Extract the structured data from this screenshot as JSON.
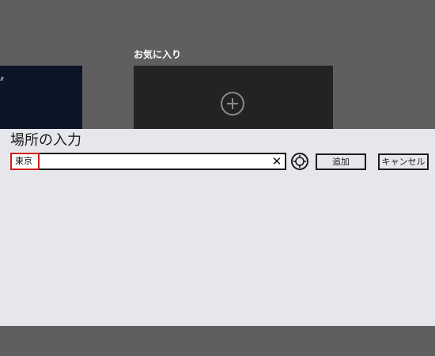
{
  "background": {
    "favorites_label": "お気に入り"
  },
  "location_panel": {
    "title": "場所の入力",
    "search_value": "東京",
    "clear_symbol": "✕",
    "add_label": "追加",
    "cancel_label": "キャンセル"
  },
  "colors": {
    "panel_bg": "#e6e7ec",
    "overlay_bg": "#5f5f5f",
    "highlight_border": "#d01b1b"
  },
  "icons": {
    "add_favorite": "plus-circle-icon",
    "clear": "close-icon",
    "current_location": "crosshair-icon"
  }
}
